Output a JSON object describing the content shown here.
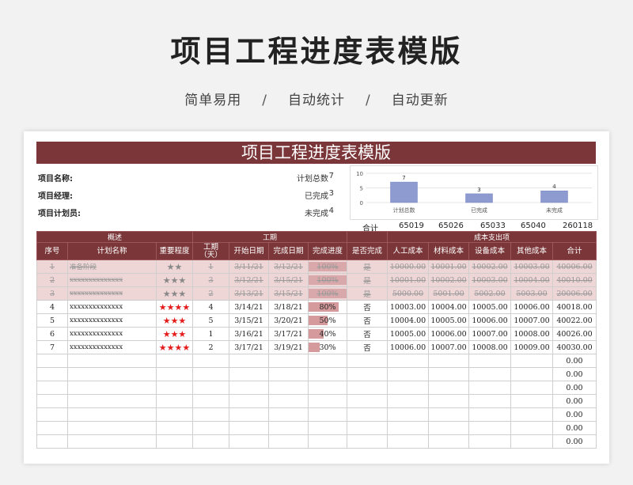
{
  "hero": {
    "title": "项目工程进度表模版",
    "tags": [
      "简单易用",
      "自动统计",
      "自动更新"
    ],
    "separator": "/"
  },
  "sheet": {
    "banner": "项目工程进度表模版",
    "info_labels": [
      "项目名称:",
      "项目经理:",
      "项目计划员:"
    ],
    "stats": [
      {
        "label": "计划总数",
        "value": "7"
      },
      {
        "label": "已完成",
        "value": "3"
      },
      {
        "label": "未完成",
        "value": "4"
      }
    ],
    "totals_label": "合计",
    "totals": [
      "65019",
      "65026",
      "65033",
      "65040",
      "260118"
    ],
    "group_headers": {
      "overview": "概述",
      "period": "工期",
      "cost": "成本支出项"
    },
    "columns": [
      "序号",
      "计划名称",
      "重要程度",
      "工期\n（天）",
      "开始日期",
      "完成日期",
      "完成进度",
      "是否完成",
      "人工成本",
      "材料成本",
      "设备成本",
      "其他成本",
      "合计"
    ],
    "rows": [
      {
        "no": "1",
        "name": "准备阶段",
        "stars": 2,
        "days": "1",
        "start": "3/11/21",
        "end": "3/12/21",
        "progress": 100,
        "progress_label": "100%",
        "done": "是",
        "labor": "10000.00",
        "material": "10001.00",
        "equipment": "10002.00",
        "other": "10003.00",
        "total": "40006.00",
        "completed": true
      },
      {
        "no": "2",
        "name": "xxxxxxxxxxxxxx",
        "stars": 3,
        "days": "3",
        "start": "3/12/21",
        "end": "3/15/21",
        "progress": 100,
        "progress_label": "100%",
        "done": "是",
        "labor": "10001.00",
        "material": "10002.00",
        "equipment": "10003.00",
        "other": "10004.00",
        "total": "40010.00",
        "completed": true
      },
      {
        "no": "3",
        "name": "xxxxxxxxxxxxxx",
        "stars": 3,
        "days": "2",
        "start": "3/13/21",
        "end": "3/15/21",
        "progress": 100,
        "progress_label": "100%",
        "done": "是",
        "labor": "5000.00",
        "material": "5001.00",
        "equipment": "5002.00",
        "other": "5003.00",
        "total": "20006.00",
        "completed": true
      },
      {
        "no": "4",
        "name": "xxxxxxxxxxxxxx",
        "stars": 4,
        "days": "4",
        "start": "3/14/21",
        "end": "3/18/21",
        "progress": 80,
        "progress_label": "80%",
        "done": "否",
        "labor": "10003.00",
        "material": "10004.00",
        "equipment": "10005.00",
        "other": "10006.00",
        "total": "40018.00",
        "completed": false
      },
      {
        "no": "5",
        "name": "xxxxxxxxxxxxxx",
        "stars": 3,
        "days": "5",
        "start": "3/15/21",
        "end": "3/20/21",
        "progress": 50,
        "progress_label": "50%",
        "done": "否",
        "labor": "10004.00",
        "material": "10005.00",
        "equipment": "10006.00",
        "other": "10007.00",
        "total": "40022.00",
        "completed": false
      },
      {
        "no": "6",
        "name": "xxxxxxxxxxxxxx",
        "stars": 3,
        "days": "1",
        "start": "3/16/21",
        "end": "3/17/21",
        "progress": 40,
        "progress_label": "40%",
        "done": "否",
        "labor": "10005.00",
        "material": "10006.00",
        "equipment": "10007.00",
        "other": "10008.00",
        "total": "40026.00",
        "completed": false
      },
      {
        "no": "7",
        "name": "xxxxxxxxxxxxxx",
        "stars": 4,
        "days": "2",
        "start": "3/17/21",
        "end": "3/19/21",
        "progress": 30,
        "progress_label": "30%",
        "done": "否",
        "labor": "10006.00",
        "material": "10007.00",
        "equipment": "10008.00",
        "other": "10009.00",
        "total": "40030.00",
        "completed": false
      }
    ],
    "empty_totals": [
      "0.00",
      "0.00",
      "0.00",
      "0.00",
      "0.00",
      "0.00",
      "0.00"
    ]
  },
  "colors": {
    "accent": "#7a3638",
    "bar": "#8e9bd0",
    "done_row": "#eed5d6",
    "star": "#e41b1b"
  },
  "chart_data": {
    "type": "bar",
    "categories": [
      "计划总数",
      "已完成",
      "未完成"
    ],
    "values": [
      7,
      3,
      4
    ],
    "ylim": [
      0,
      10
    ],
    "yticks": [
      "0",
      "5",
      "10"
    ],
    "grid": true,
    "legend": "none"
  }
}
